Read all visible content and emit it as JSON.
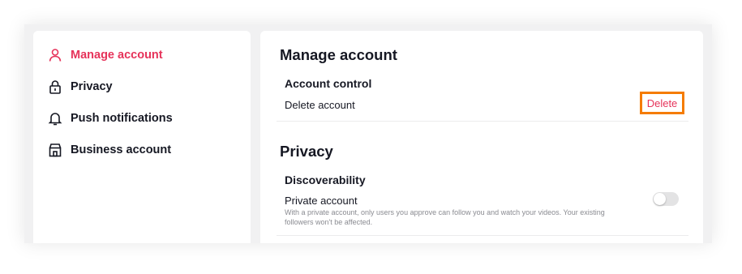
{
  "colors": {
    "accent": "#e6335a",
    "highlight_border": "#f57c00",
    "text": "#161823",
    "muted": "#8a8b91",
    "toggle_off": "#e3e3e4"
  },
  "sidebar": {
    "items": [
      {
        "label": "Manage account",
        "icon": "person-icon",
        "active": true
      },
      {
        "label": "Privacy",
        "icon": "lock-icon",
        "active": false
      },
      {
        "label": "Push notifications",
        "icon": "bell-icon",
        "active": false
      },
      {
        "label": "Business account",
        "icon": "store-icon",
        "active": false
      }
    ]
  },
  "main": {
    "manage_account": {
      "title": "Manage account",
      "account_control": {
        "title": "Account control",
        "delete_label": "Delete account",
        "delete_button": "Delete"
      }
    },
    "privacy": {
      "title": "Privacy",
      "discoverability": {
        "title": "Discoverability",
        "private_account_label": "Private account",
        "private_account_desc": "With a private account, only users you approve can follow you and watch your videos. Your existing followers won't be affected.",
        "private_account_enabled": false
      }
    }
  }
}
